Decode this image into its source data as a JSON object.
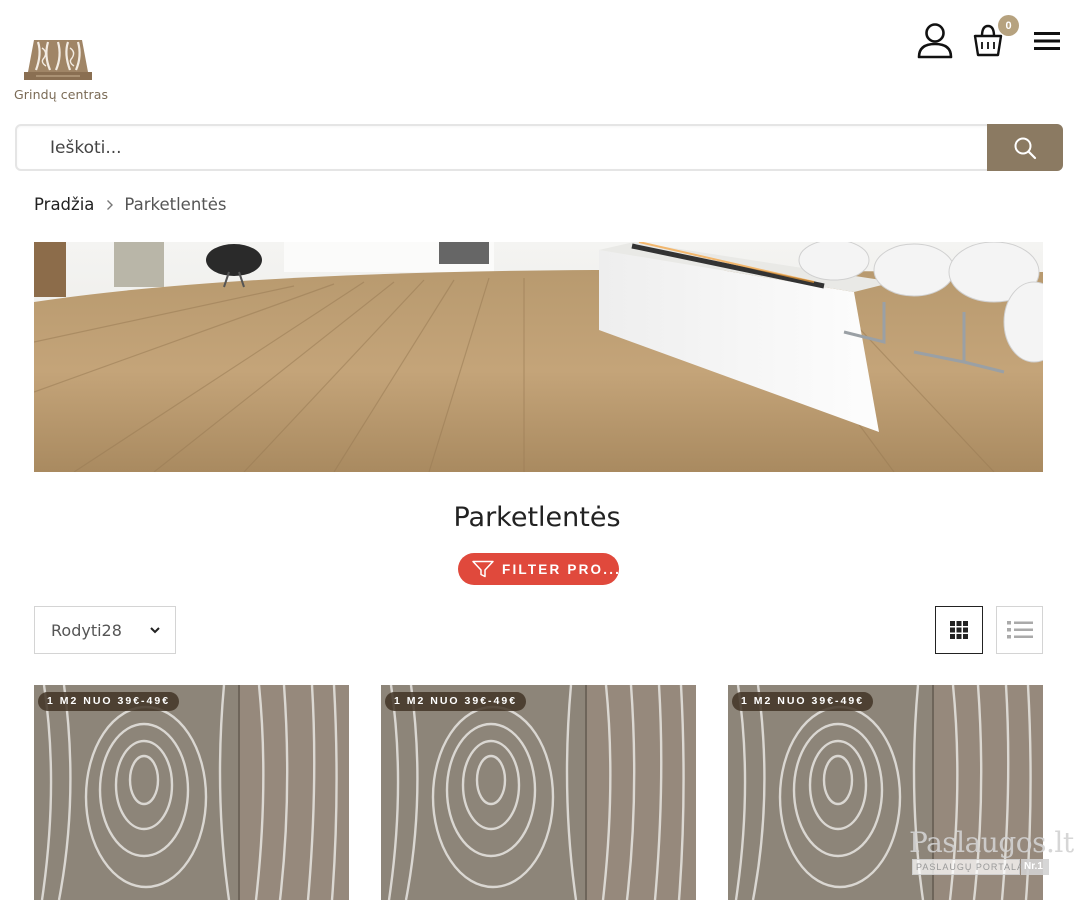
{
  "header": {
    "logo_text": "Grindų centras",
    "cart_count": "0"
  },
  "search": {
    "placeholder": "Ieškoti..."
  },
  "breadcrumb": {
    "home": "Pradžia",
    "current": "Parketlentės"
  },
  "page": {
    "title": "Parketlentės",
    "filter_label": "FILTER PRO..."
  },
  "toolbar": {
    "per_page_label": "Rodyti28"
  },
  "products": [
    {
      "badge": "1 M2 NUO 39€-49€"
    },
    {
      "badge": "1 M2 NUO 39€-49€"
    },
    {
      "badge": "1 M2 NUO 39€-49€"
    }
  ],
  "watermark": {
    "title": "Paslaugos.lt",
    "subtitle": "PASLAUGŲ PORTALAS",
    "rank": "Nr.1"
  },
  "colors": {
    "accent": "#8b7a62",
    "filter_button": "#e0493c",
    "cart_badge": "#b6a27f"
  },
  "icons": [
    "user-icon",
    "cart-icon",
    "menu-icon",
    "search-icon",
    "chevron-right-icon",
    "filter-icon",
    "chevron-down-icon",
    "grid-view-icon",
    "list-view-icon"
  ]
}
